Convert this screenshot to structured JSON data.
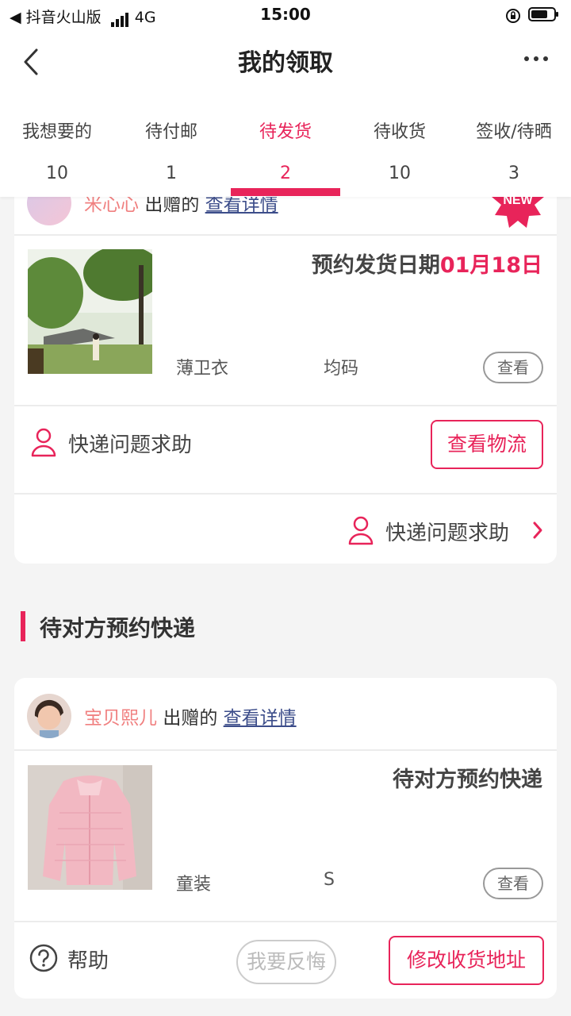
{
  "status_bar": {
    "app": "抖音火山版",
    "network": "4G",
    "time": "15:00"
  },
  "header": {
    "title": "我的领取"
  },
  "tabs": [
    {
      "label": "我想要的",
      "count": "10"
    },
    {
      "label": "待付邮",
      "count": "1"
    },
    {
      "label": "待发货",
      "count": "2",
      "active": true
    },
    {
      "label": "待收货",
      "count": "10"
    },
    {
      "label": "签收/待晒",
      "count": "3"
    }
  ],
  "card1": {
    "user": "米心心",
    "gift_text": "出赠的",
    "detail_link": "查看详情",
    "badge": "NEW",
    "date_prefix": "预约发货日期",
    "date_value": "01月18日",
    "item_name": "薄卫衣",
    "item_size": "均码",
    "view_button": "查看",
    "help_text": "快递问题求助",
    "logistics_button": "查看物流",
    "help_text_2": "快递问题求助"
  },
  "section": {
    "title": "待对方预约快递"
  },
  "card2": {
    "user": "宝贝熙儿",
    "gift_text": "出赠的",
    "detail_link": "查看详情",
    "status": "待对方预约快递",
    "item_name": "童装",
    "item_size": "S",
    "view_button": "查看",
    "help_label": "帮助",
    "regret_button": "我要反悔",
    "address_button": "修改收货地址"
  },
  "colors": {
    "accent": "#e8245a",
    "link": "#3c4d8a",
    "background": "#f4f4f4"
  }
}
